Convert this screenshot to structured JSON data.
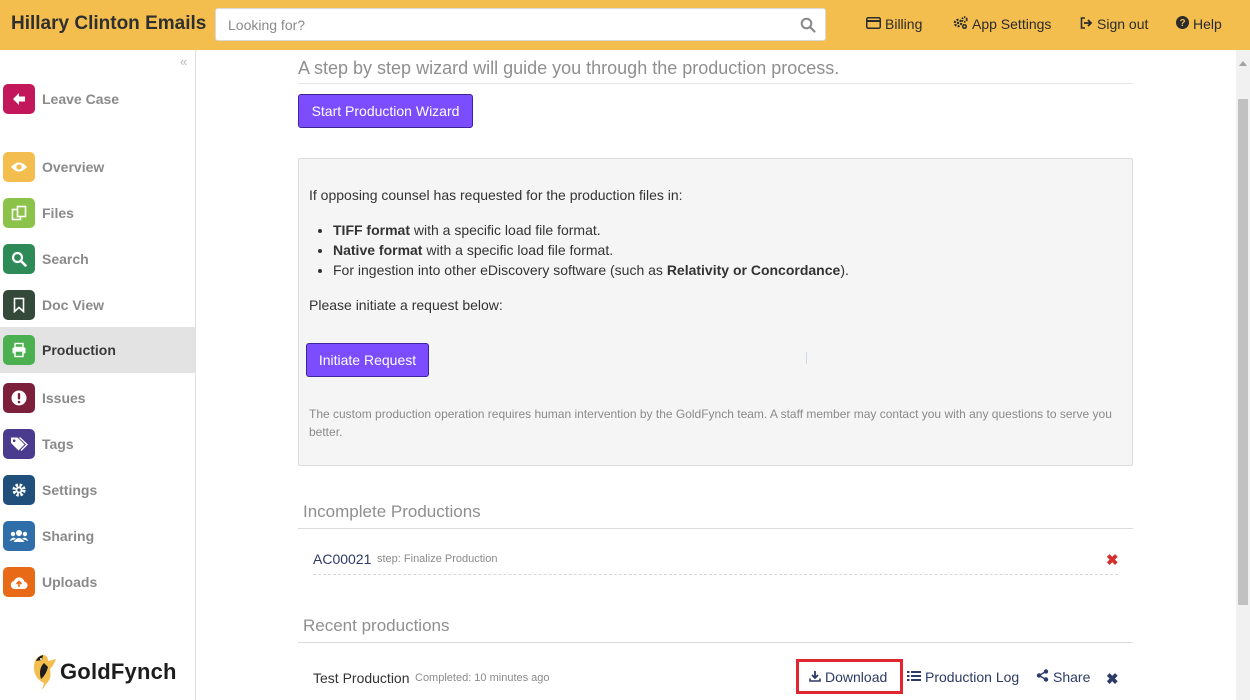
{
  "header": {
    "title": "Hillary Clinton Emails",
    "search_placeholder": "Looking for?",
    "nav": {
      "billing": "Billing",
      "app_settings": "App Settings",
      "sign_out": "Sign out",
      "help": "Help"
    }
  },
  "sidebar": {
    "items": [
      {
        "label": "Leave Case",
        "icon": "arrow-left-icon",
        "color": "#c2185b"
      },
      {
        "label": "Overview",
        "icon": "eye-icon",
        "color": "#f3be4e"
      },
      {
        "label": "Files",
        "icon": "files-icon",
        "color": "#8bc34a"
      },
      {
        "label": "Search",
        "icon": "search-icon",
        "color": "#2e8b57"
      },
      {
        "label": "Doc View",
        "icon": "bookmark-icon",
        "color": "#34493a"
      },
      {
        "label": "Production",
        "icon": "printer-icon",
        "color": "#4caf50"
      },
      {
        "label": "Issues",
        "icon": "exclamation-icon",
        "color": "#7b1f3a"
      },
      {
        "label": "Tags",
        "icon": "tags-icon",
        "color": "#4a3b8f"
      },
      {
        "label": "Settings",
        "icon": "gear-icon",
        "color": "#1f4f7a"
      },
      {
        "label": "Sharing",
        "icon": "users-icon",
        "color": "#2f6ea8"
      },
      {
        "label": "Uploads",
        "icon": "cloud-upload-icon",
        "color": "#e86a17"
      }
    ],
    "active": "Production",
    "logo_text": "GoldFynch"
  },
  "main": {
    "intro": "A step by step wizard will guide you through the production process.",
    "wizard_button": "Start Production Wizard",
    "panel": {
      "line1": "If opposing counsel has requested for the production files in:",
      "bullet1_bold": "TIFF format",
      "bullet1_rest": " with a specific load file format.",
      "bullet2_bold": "Native format",
      "bullet2_rest": " with a specific load file format.",
      "bullet3_pre": "For ingestion into other eDiscovery software (such as ",
      "bullet3_bold": "Relativity or Concordance",
      "bullet3_post": ").",
      "line2": "Please initiate a request below:",
      "initiate_button": "Initiate Request",
      "note": "The custom production operation requires human intervention by the GoldFynch team. A staff member may contact you with any questions to serve you better."
    },
    "incomplete": {
      "title": "Incomplete Productions",
      "items": [
        {
          "name": "AC00021",
          "status": "step: Finalize Production"
        }
      ]
    },
    "recent": {
      "title": "Recent productions",
      "items": [
        {
          "name": "Test Production",
          "status": "Completed: 10 minutes ago",
          "download": "Download",
          "log": "Production Log",
          "share": "Share"
        }
      ]
    }
  },
  "colors": {
    "topbar": "#f3be4e",
    "accent_button": "#7b4dff",
    "link": "#2e3a66",
    "delete_red": "#d32f2f",
    "highlight_box": "#e0262e"
  }
}
